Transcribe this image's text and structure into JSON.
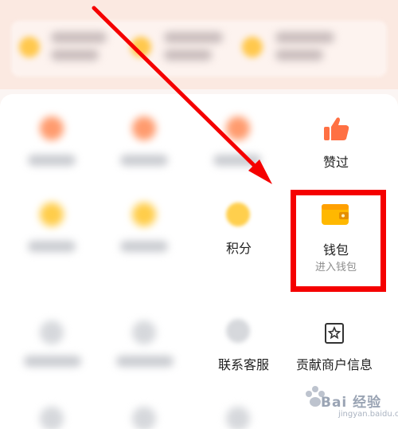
{
  "grid": {
    "likes_label": "赞过",
    "points_label": "积分",
    "wallet_label": "钱包",
    "wallet_sub": "进入钱包",
    "contact_service_label": "联系客服",
    "contribute_merchant_label": "贡献商户信息"
  },
  "icons": {
    "likes": "thumbs-up-icon",
    "wallet": "wallet-icon",
    "contribute": "shop-info-icon",
    "points": "coin-icon"
  },
  "colors": {
    "highlight": "#f50000",
    "arrow": "#f50000",
    "thumb": "#ff7043",
    "wallet": "#ffb800"
  },
  "watermark": {
    "brand": "Bai 经验",
    "sub": "jingyan.baidu.com"
  }
}
